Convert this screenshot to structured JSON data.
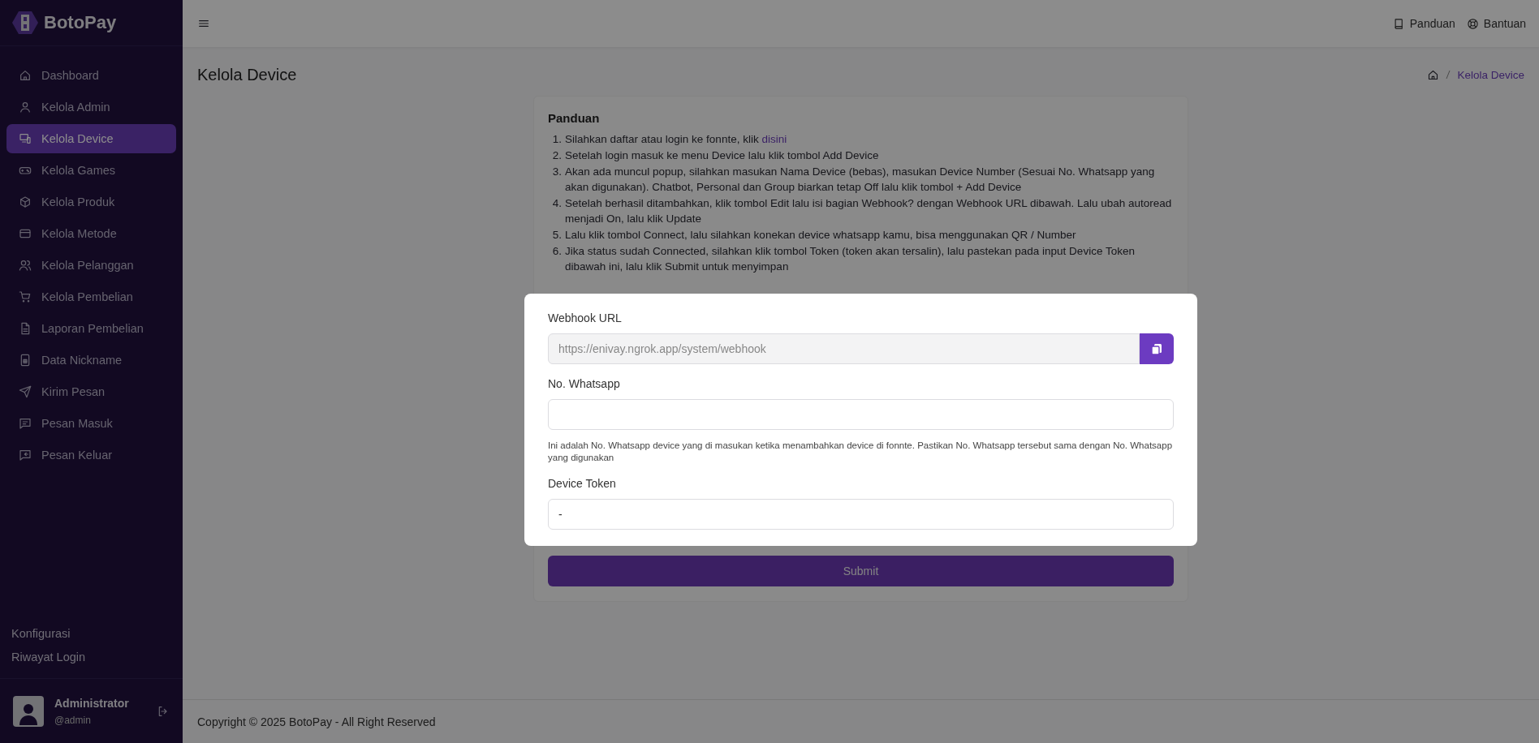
{
  "sidebar": {
    "brand": "BotoPay",
    "items": [
      {
        "label": "Dashboard",
        "selected": false
      },
      {
        "label": "Kelola Admin",
        "selected": false
      },
      {
        "label": "Kelola Device",
        "selected": true
      },
      {
        "label": "Kelola Games",
        "selected": false
      },
      {
        "label": "Kelola Produk",
        "selected": false
      },
      {
        "label": "Kelola Metode",
        "selected": false
      },
      {
        "label": "Kelola Pelanggan",
        "selected": false
      },
      {
        "label": "Kelola Pembelian",
        "selected": false
      },
      {
        "label": "Laporan Pembelian",
        "selected": false
      },
      {
        "label": "Data Nickname",
        "selected": false
      },
      {
        "label": "Kirim Pesan",
        "selected": false
      },
      {
        "label": "Pesan Masuk",
        "selected": false
      },
      {
        "label": "Pesan Keluar",
        "selected": false
      }
    ],
    "bottom_links": [
      "Konfigurasi",
      "Riwayat Login"
    ],
    "user": {
      "name": "Administrator",
      "handle": "@admin"
    }
  },
  "topbar": {
    "links": [
      "Panduan",
      "Bantuan"
    ]
  },
  "page": {
    "title": "Kelola Device",
    "breadcrumb": "Kelola Device"
  },
  "guide": {
    "title": "Panduan",
    "steps": [
      {
        "number": "1.",
        "text": "Silahkan daftar atau login ke fonnte, klik",
        "link": "disini"
      },
      {
        "number": "2.",
        "text": "Setelah login masuk ke menu Device lalu klik tombol Add Device"
      },
      {
        "number": "3.",
        "text": "Akan ada muncul popup, silahkan masukan Nama Device (bebas), masukan Device Number (Sesuai No. Whatsapp yang akan digunakan). Chatbot, Personal dan Group biarkan tetap Off lalu klik tombol + Add Device"
      },
      {
        "number": "4.",
        "text": "Setelah berhasil ditambahkan, klik tombol Edit lalu isi bagian Webhook? dengan Webhook URL dibawah. Lalu ubah autoread menjadi On, lalu klik Update"
      },
      {
        "number": "5.",
        "text": "Lalu klik tombol Connect, lalu silahkan konekan device whatsapp kamu, bisa menggunakan QR / Number"
      },
      {
        "number": "6.",
        "text": "Jika status sudah Connected, silahkan klik tombol Token (token akan tersalin), lalu pastekan pada input Device Token dibawah ini, lalu klik Submit untuk menyimpan"
      }
    ]
  },
  "form": {
    "highlighted": true,
    "fields": [
      {
        "kind": "copy",
        "label": "Webhook URL",
        "value": "https://enivay.ngrok.app/system/webhook",
        "disabled": true
      },
      {
        "kind": "text",
        "label": "No. Whatsapp",
        "disabled": false,
        "help": "Ini adalah No. Whatsapp device yang di masukan ketika menambahkan device di fonnte. Pastikan No. Whatsapp tersebut sama dengan No. Whatsapp yang digunakan"
      },
      {
        "kind": "text",
        "label": "Device Token",
        "value": "-",
        "disabled": false
      }
    ],
    "submit": "Submit"
  },
  "footer": {
    "copyright": "Copyright © 2025 BotoPay - All Right Reserved"
  }
}
